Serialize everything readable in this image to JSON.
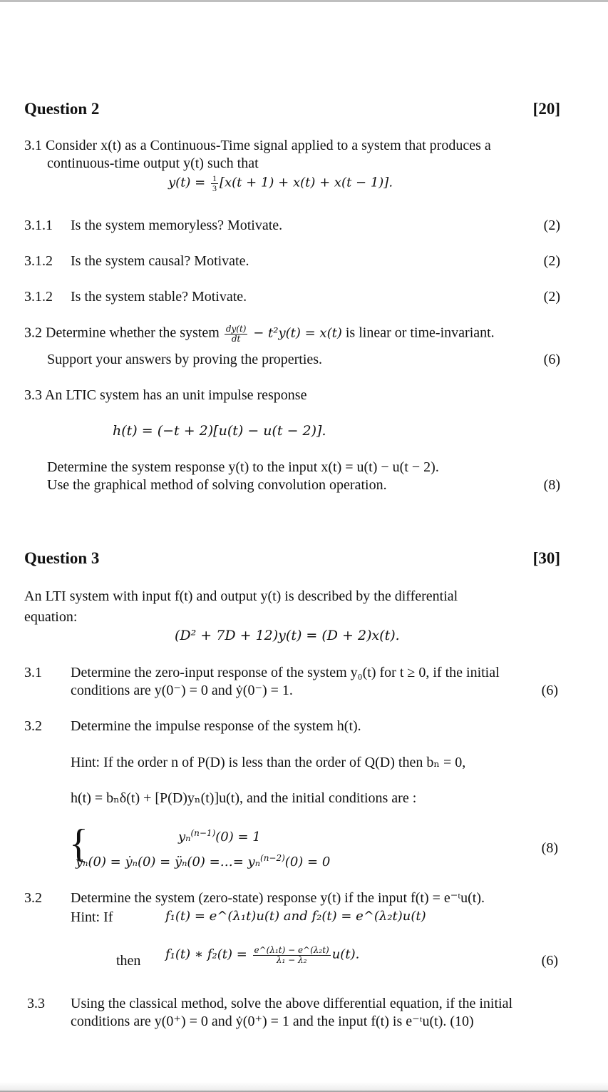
{
  "q2": {
    "heading": "Question 2",
    "marks": "[20]",
    "q31": {
      "line1": "3.1 Consider x(t) as a Continuous-Time signal applied to a system that produces a",
      "line2": "continuous-time output y(t) such that",
      "equation": "y(t) = ⅓[x(t + 1) + x(t) + x(t − 1)].",
      "eq_lhs": "y(t) = ",
      "eq_frac_num": "1",
      "eq_frac_den": "3",
      "eq_rhs": "[x(t + 1) + x(t) + x(t − 1)]."
    },
    "subitems": [
      {
        "number": "3.1.1",
        "text": "Is the system memoryless? Motivate.",
        "marks": "(2)"
      },
      {
        "number": "3.1.2",
        "text": "Is the system causal? Motivate.",
        "marks": "(2)"
      },
      {
        "number": "3.1.2",
        "text": "Is the system stable? Motivate.",
        "marks": "(2)"
      }
    ],
    "q32": {
      "prefix": "3.2 Determine whether the system ",
      "frac_num": "dy(t)",
      "frac_den": "dt",
      "equation_rest": " − t²y(t) = x(t)",
      "suffix": " is linear or time-invariant.",
      "line2": "Support your answers by proving the properties.",
      "marks": "(6)"
    },
    "q33": {
      "line1": "3.3 An LTIC system has an unit impulse response",
      "equation": "h(t) = (−t + 2)[u(t) − u(t − 2)].",
      "line2": "Determine the system response y(t) to the input x(t) = u(t) − u(t − 2).",
      "line3": "Use the graphical method of solving convolution operation.",
      "marks": "(8)"
    }
  },
  "q3": {
    "heading": "Question 3",
    "marks": "[30]",
    "intro_line1": "An LTI system with input f(t) and output y(t) is described by the differential",
    "intro_line2": "equation:",
    "equation": "(D² + 7D + 12)y(t) = (D + 2)x(t).",
    "items": [
      {
        "number": "3.1",
        "line1": "Determine the zero-input response of the system y₀(t) for t ≥ 0, if the initial",
        "line2": "conditions are y(0⁻) = 0 and ẏ(0⁻) = 1.",
        "marks": "(6)"
      },
      {
        "number": "3.2",
        "line1": "Determine the impulse response of the system h(t).",
        "hint1": "Hint: If the order n of P(D)  is less than the order of Q(D) then  bₙ = 0,",
        "hint2": "h(t) = bₙδ(t) + [P(D)yₙ(t)]u(t), and the initial conditions are :",
        "cond1_base": "yₙ",
        "cond1_sup": "(n−1)",
        "cond1_rest": "(0) = 1",
        "cond2_base": "yₙ(0) = ẏₙ(0) = ÿₙ(0) =…= yₙ",
        "cond2_sup": "(n−2)",
        "cond2_rest": "(0) = 0",
        "marks": "(8)"
      },
      {
        "number": "3.2",
        "line1": "Determine the system (zero-state) response y(t) if the input f(t) = e⁻ᵗu(t).",
        "hint_label": "Hint:   If",
        "hint_eq": "f₁(t) = e^(λ₁t)u(t) and f₂(t) = e^(λ₂t)u(t)",
        "then_label": "then",
        "then_lhs": "f₁(t) ∗ f₂(t) = ",
        "then_num": "e^(λ₁t) − e^(λ₂t)",
        "then_den": "λ₁ − λ₂",
        "then_rest": "u(t).",
        "marks": "(6)"
      },
      {
        "number": "3.3",
        "line1": "Using the classical method, solve the above differential equation, if the initial",
        "line2": "conditions are y(0⁺) = 0 and ẏ(0⁺) = 1 and the input  f(t)  is e⁻ᵗu(t). (10)"
      }
    ]
  }
}
